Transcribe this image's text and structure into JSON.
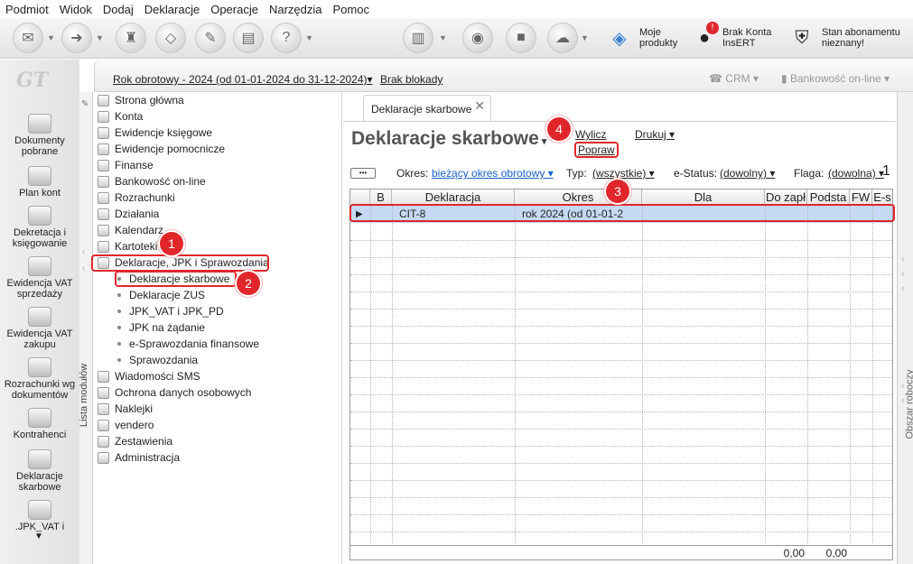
{
  "menu": [
    "Podmiot",
    "Widok",
    "Dodaj",
    "Deklaracje",
    "Operacje",
    "Narzędzia",
    "Pomoc"
  ],
  "toolbar": {
    "moje_produkty": "Moje\nprodukty",
    "brak_konta_1": "Brak Konta",
    "brak_konta_2": "InsERT",
    "stan_1": "Stan abonamentu",
    "stan_2": "nieznany!",
    "notification_count": "!"
  },
  "sidebar": {
    "logo": "GT",
    "items": [
      "Dokumenty pobrane",
      "Plan kont",
      "Dekretacja i księgowanie",
      "Ewidencja VAT sprzedaży",
      "Ewidencja VAT zakupu",
      "Rozrachunki wg dokumentów",
      "Kontrahenci",
      "Deklaracje skarbowe",
      ".JPK_VAT i"
    ],
    "vertical_label": "Lista modułów"
  },
  "topstrip": {
    "rok": "Rok obrotowy - 2024  (od 01-01-2024 do 31-12-2024)▾",
    "blokady": "Brak blokady",
    "crm": "CRM ▾",
    "bankowosc": "Bankowość on-line ▾"
  },
  "tree": {
    "nodes": [
      "Strona główna",
      "Konta",
      "Ewidencje księgowe",
      "Ewidencje pomocnicze",
      "Finanse",
      "Bankowość on-line",
      "Rozrachunki",
      "Działania",
      "Kalendarz",
      "Kartoteki",
      "Deklaracje, JPK i Sprawozdania"
    ],
    "subnodes": [
      "Deklaracje skarbowe",
      "Deklaracje ZUS",
      "JPK_VAT i JPK_PD",
      "JPK na żądanie",
      "e-Sprawozdania finansowe",
      "Sprawozdania"
    ],
    "nodes2": [
      "Wiadomości SMS",
      "Ochrona danych osobowych",
      "Naklejki",
      "vendero",
      "Zestawienia",
      "Administracja"
    ]
  },
  "tab": {
    "label": "Deklaracje skarbowe",
    "close": "✕"
  },
  "page": {
    "title": "Deklaracje skarbowe",
    "wylicz": "Wylicz",
    "popraw": "Popraw",
    "drukuj": "Drukuj ▾"
  },
  "filters": {
    "more": "•••",
    "okres_label": "Okres:",
    "okres_value": "bieżący okres obrotowy ▾",
    "typ_label": "Typ:",
    "typ_value": "(wszystkie) ▾",
    "estatus_label": "e-Status:",
    "estatus_value": "(dowolny) ▾",
    "flaga_label": "Flaga:",
    "flaga_value": "(dowolna) ▾",
    "count": "1"
  },
  "grid": {
    "headers": [
      "B",
      "Deklaracja",
      "Okres",
      "Dla",
      "Do zapł",
      "Podsta",
      "FW",
      "E-s"
    ],
    "row": {
      "marker": "▶",
      "deklaracja": "CIT-8",
      "okres": "rok 2024 (od 01-01-2"
    },
    "footer": [
      "0,00",
      "0,00"
    ]
  },
  "badges": [
    "1",
    "2",
    "3",
    "4"
  ],
  "rightbar": {
    "label": "Obszar roboczy"
  },
  "colors": {
    "highlight": "#e0262b",
    "selected_row": "#c5daf2",
    "link": "#1a5fc9"
  }
}
